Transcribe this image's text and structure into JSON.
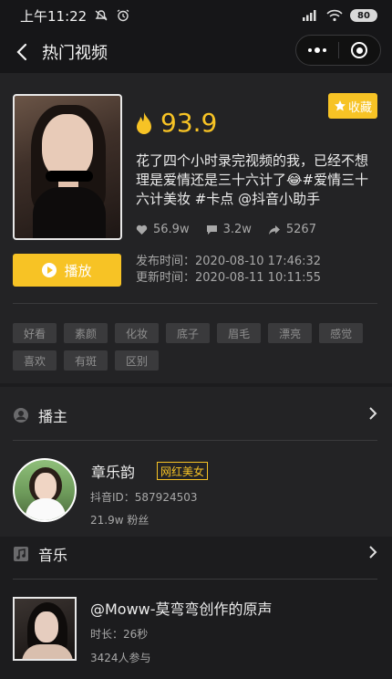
{
  "status_bar": {
    "time": "上午11:22",
    "battery": "80"
  },
  "nav": {
    "title": "热门视频"
  },
  "video": {
    "favorite_label": "收藏",
    "heat_score": "93.9",
    "description": "花了四个小时录完视频的我，已经不想理是爱情还是三十六计了😂#爱情三十六计美妆 #卡点 @抖音小助手",
    "likes": "56.9w",
    "comments": "3.2w",
    "shares": "5267",
    "play_label": "播放",
    "published": "发布时间：2020-08-10 17:46:32",
    "updated": "更新时间：2020-08-11 10:11:55",
    "tags": [
      "好看",
      "素颜",
      "化妆",
      "底子",
      "眉毛",
      "漂亮",
      "感觉",
      "喜欢",
      "有斑",
      "区别"
    ]
  },
  "anchor": {
    "section_label": "播主",
    "name": "章乐韵",
    "badge": "网红美女",
    "douyin_id": "抖音ID：587924503",
    "fans": "21.9w 粉丝"
  },
  "music": {
    "section_label": "音乐",
    "title": "@Moww-莫弯弯创作的原声",
    "duration": "时长：26秒",
    "participants": "3424人参与"
  },
  "colors": {
    "accent": "#f7c325",
    "background": "#1c1c1e",
    "card": "#232325"
  }
}
